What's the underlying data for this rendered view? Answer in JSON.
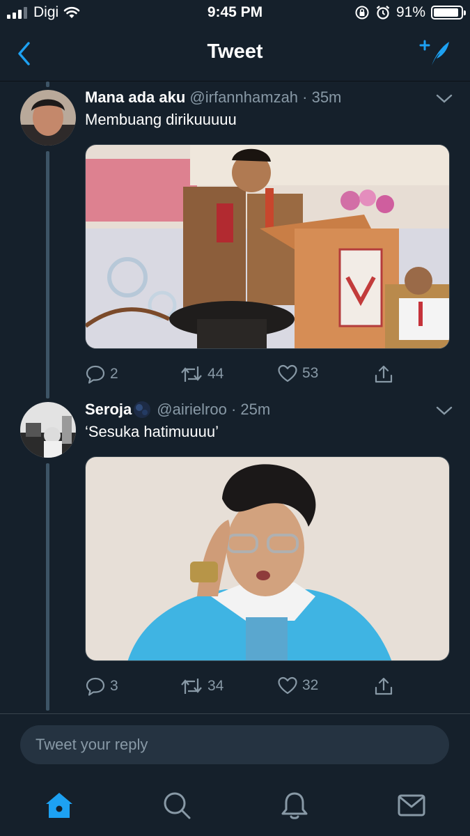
{
  "status_bar": {
    "carrier": "Digi",
    "time": "9:45 PM",
    "battery": "91%",
    "battery_level": 0.91
  },
  "nav": {
    "title": "Tweet",
    "back_icon": "chevron-left-icon",
    "compose_icon": "compose-feather-icon"
  },
  "tweets": [
    {
      "name": "Mana ada aku",
      "meta": "@irfannhamzah · 35m",
      "text": "Membuang dirikuuuuu",
      "replies": "2",
      "retweets": "44",
      "likes": "53"
    },
    {
      "name": "Seroja",
      "meta": "@airielroo · 25m",
      "text": "‘Sesuka hatimuuuu’",
      "replies": "3",
      "retweets": "34",
      "likes": "32"
    }
  ],
  "reply": {
    "placeholder": "Tweet your reply"
  },
  "tabs": [
    "home-icon",
    "search-icon",
    "notifications-bell-icon",
    "messages-mail-icon"
  ],
  "colors": {
    "background": "#15202b",
    "accent": "#1da1f2",
    "secondary_text": "#8899a6",
    "thread_line": "#3d5466"
  }
}
